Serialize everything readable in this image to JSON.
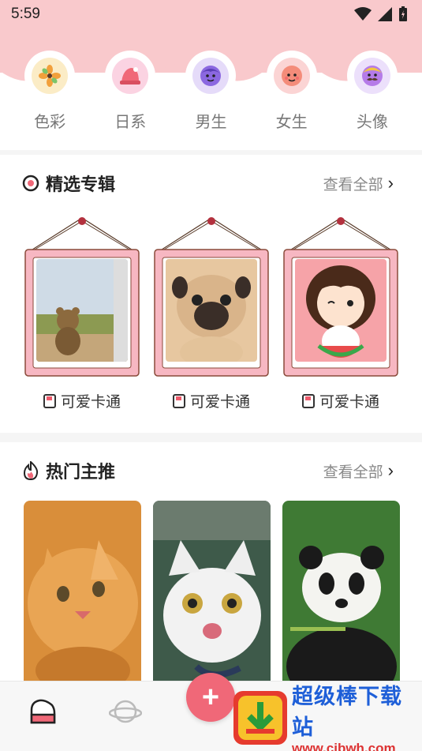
{
  "status_bar": {
    "time": "5:59"
  },
  "categories": [
    {
      "label": "色彩",
      "icon": "flower-icon",
      "bg": "#fbecc6"
    },
    {
      "label": "日系",
      "icon": "hat-icon",
      "bg": "#fbd3e2"
    },
    {
      "label": "男生",
      "icon": "boy-face-icon",
      "bg": "#e5dbf9"
    },
    {
      "label": "女生",
      "icon": "girl-face-icon",
      "bg": "#fbd4d4"
    },
    {
      "label": "头像",
      "icon": "mustache-face-icon",
      "bg": "#ece0fb"
    }
  ],
  "featured": {
    "title": "精选专辑",
    "see_all": "查看全部",
    "items": [
      {
        "caption": "可爱卡通",
        "photo": "teddy-bear-photo"
      },
      {
        "caption": "可爱卡通",
        "photo": "pug-photo"
      },
      {
        "caption": "可爱卡通",
        "photo": "cartoon-girl-photo"
      }
    ]
  },
  "hot": {
    "title": "热门主推",
    "see_all": "查看全部",
    "items": [
      {
        "photo": "orange-kitten-photo"
      },
      {
        "photo": "white-cat-photo"
      },
      {
        "photo": "panda-photo"
      }
    ]
  },
  "fab": {
    "label": "+"
  },
  "watermark": {
    "main": "超级棒下载站",
    "url": "www.cjbwh.com"
  },
  "colors": {
    "accent": "#f06878",
    "header_pink": "#f9c9cc"
  }
}
